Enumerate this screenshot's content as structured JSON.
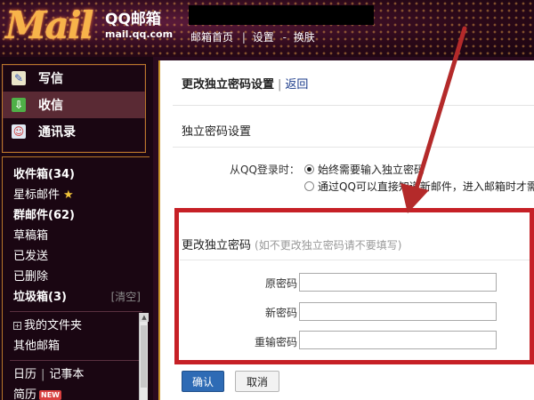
{
  "header": {
    "logo_text": "Mail",
    "brand_cn": "QQ邮箱",
    "brand_url": "mail.qq.com",
    "nav_home": "邮箱首页",
    "nav_sep": "|",
    "nav_settings": "设置",
    "nav_dash": "-",
    "nav_skin": "换肤"
  },
  "sidebar": {
    "compose": [
      {
        "label": "写信",
        "icon": "pencil-icon"
      },
      {
        "label": "收信",
        "icon": "inbox-icon"
      },
      {
        "label": "通讯录",
        "icon": "contacts-icon"
      }
    ],
    "folders": {
      "inbox": "收件箱(34)",
      "starred": "星标邮件",
      "star_glyph": "★",
      "group": "群邮件(62)",
      "drafts": "草稿箱",
      "sent": "已发送",
      "deleted": "已删除",
      "spam": "垃圾箱(3)",
      "clear": "[清空]"
    },
    "my_folders_expand": "+",
    "my_folders": "我的文件夹",
    "other_mailbox": "其他邮箱",
    "calendar": "日历",
    "tools_sep": "|",
    "notepad": "记事本",
    "resume": "简历",
    "new_badge": "NEW"
  },
  "main": {
    "page_title": "更改独立密码设置",
    "title_sep": "|",
    "back_link": "返回",
    "section_title": "独立密码设置",
    "qq_login_label": "从QQ登录时：",
    "radio_options": [
      {
        "label": "始终需要输入独立密码",
        "checked": true
      },
      {
        "label": "通过QQ可以直接知道新邮件，进入邮箱时才需",
        "checked": false
      }
    ],
    "change_title": "更改独立密码",
    "change_hint": "(如不更改独立密码请不要填写)",
    "fields": [
      {
        "label": "原密码：",
        "value": ""
      },
      {
        "label": "新密码：",
        "value": ""
      },
      {
        "label": "重输密码：",
        "value": ""
      }
    ],
    "confirm_button": "确认",
    "cancel_button": "取消"
  },
  "colors": {
    "highlight_box": "#c62026",
    "annotation_arrow": "#b42a2a",
    "confirm_button": "#2e6bb5",
    "sidebar_border": "#b9772a",
    "header_gold": "#f7b34a"
  }
}
